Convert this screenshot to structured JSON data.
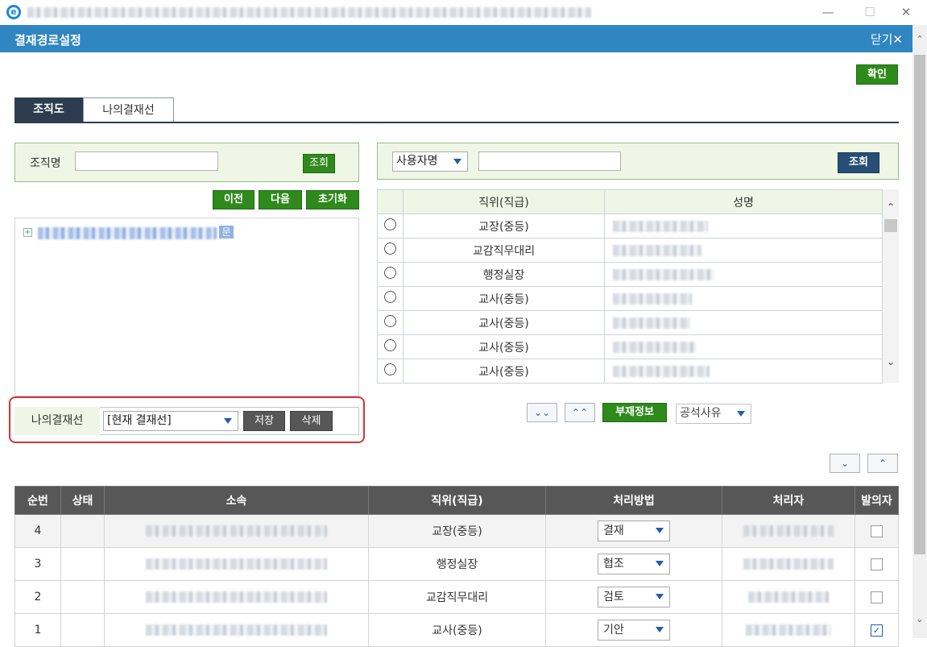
{
  "window": {
    "minimize": "—",
    "maximize": "☐",
    "close": "✕"
  },
  "header": {
    "title": "결재경로설정",
    "close_label": "닫기✕"
  },
  "confirm_label": "확인",
  "tabs": [
    {
      "label": "조직도",
      "active": true
    },
    {
      "label": "나의결재선",
      "active": false
    }
  ],
  "org_search": {
    "label": "조직명",
    "value": "",
    "button": "조회"
  },
  "user_search": {
    "field": "사용자명",
    "value": "",
    "button": "조회"
  },
  "nav_buttons": {
    "prev": "이전",
    "next": "다음",
    "reset": "초기화"
  },
  "tree": {
    "badge": "문"
  },
  "my_line": {
    "label": "나의결재선",
    "selected": "[현재 결재선]",
    "save": "저장",
    "delete": "삭제"
  },
  "user_table": {
    "columns": [
      "",
      "직위(직급)",
      "성명"
    ],
    "rows": [
      {
        "position": "교장(중등)"
      },
      {
        "position": "교감직무대리"
      },
      {
        "position": "행정실장"
      },
      {
        "position": "교사(중등)"
      },
      {
        "position": "교사(중등)"
      },
      {
        "position": "교사(중등)"
      },
      {
        "position": "교사(중등)"
      }
    ]
  },
  "mid_actions": {
    "down_all": "⌄⌄",
    "up_all": "⌃⌃",
    "absence_info": "부재정보",
    "absence_reason": "공석사유"
  },
  "row_move": {
    "down": "⌄",
    "up": "⌃"
  },
  "approval_table": {
    "columns": [
      "순번",
      "상태",
      "소속",
      "직위(직급)",
      "처리방법",
      "처리자",
      "발의자"
    ],
    "rows": [
      {
        "order": "4",
        "status": "",
        "position": "교장(중등)",
        "method": "결재",
        "proposer": false
      },
      {
        "order": "3",
        "status": "",
        "position": "행정실장",
        "method": "협조",
        "proposer": false
      },
      {
        "order": "2",
        "status": "",
        "position": "교감직무대리",
        "method": "검토",
        "proposer": false
      },
      {
        "order": "1",
        "status": "",
        "position": "교사(중등)",
        "method": "기안",
        "proposer": true
      }
    ]
  },
  "colors": {
    "header_blue": "#2f86c1",
    "green_button": "#2f8a1c",
    "navy_button": "#274f75",
    "tab_active": "#2d3d4f",
    "highlight_red": "#d7333a"
  }
}
